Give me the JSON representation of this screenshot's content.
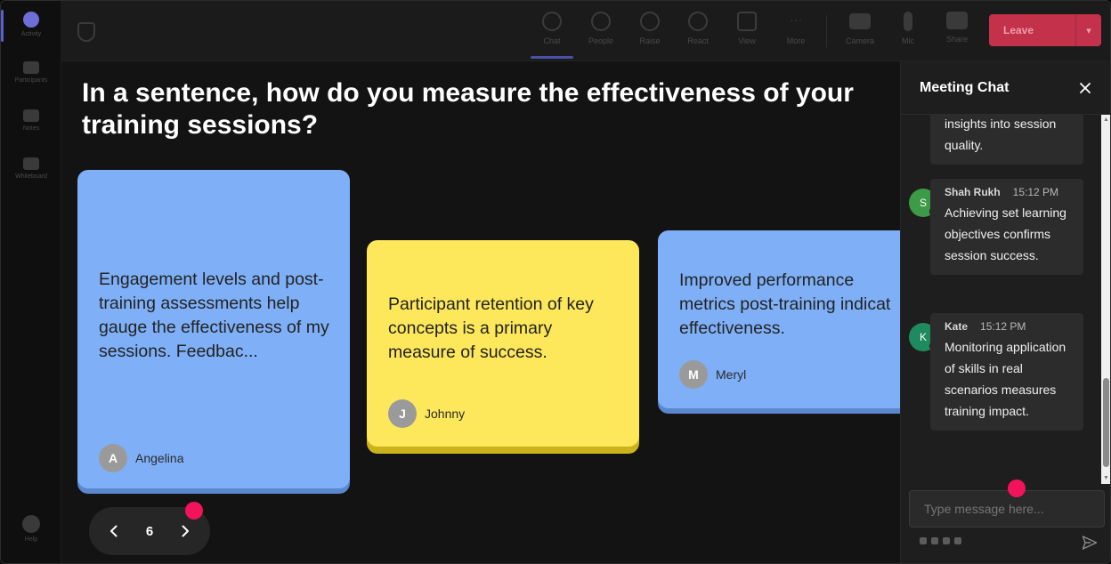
{
  "rail": {
    "items": [
      {
        "label": "Activity"
      },
      {
        "label": "Participants"
      },
      {
        "label": "Notes"
      },
      {
        "label": "Whiteboard"
      },
      {
        "label": "Help"
      }
    ]
  },
  "toolbar": {
    "items": [
      {
        "label": "Chat",
        "icon": "chat-icon"
      },
      {
        "label": "People",
        "icon": "people-icon"
      },
      {
        "label": "Raise",
        "icon": "hand-icon"
      },
      {
        "label": "React",
        "icon": "smile-icon"
      },
      {
        "label": "View",
        "icon": "grid-icon"
      },
      {
        "label": "More",
        "icon": "more-icon"
      },
      {
        "label": "Camera",
        "icon": "camera-icon"
      },
      {
        "label": "Mic",
        "icon": "mic-icon"
      },
      {
        "label": "Share",
        "icon": "share-icon"
      }
    ],
    "leave_label": "Leave"
  },
  "stage": {
    "question": "In a sentence, how do you measure the effectiveness of your training sessions?",
    "cards": [
      {
        "text": "Engagement levels and post-training assessments help gauge the effectiveness of my sessions. Feedbac...",
        "author": "Angelina",
        "initial": "A",
        "color": "#7fb0f7"
      },
      {
        "text": "Participant retention of key concepts is a primary measure of success.",
        "author": "Johnny",
        "initial": "J",
        "color": "#fde85c"
      },
      {
        "text": "Improved performance metrics post-training indicat effectiveness.",
        "author": "Meryl",
        "initial": "M",
        "color": "#7fb0f7"
      }
    ],
    "pager": {
      "page": "6"
    }
  },
  "chat": {
    "title": "Meeting Chat",
    "messages": [
      {
        "name": "",
        "time": "",
        "text": "insights into session quality."
      },
      {
        "name": "Shah Rukh",
        "time": "15:12 PM",
        "initial": "S",
        "avatar_color": "#3d9a46",
        "text": "Achieving set learning objectives confirms session success."
      },
      {
        "name": "Kate",
        "time": "15:12 PM",
        "initial": "K",
        "avatar_color": "#1f8a5e",
        "text": "Monitoring application of skills in real scenarios measures training impact."
      }
    ],
    "compose_placeholder": "Type message here..."
  },
  "colors": {
    "accent": "#5b5fc7",
    "leave": "#c4314b",
    "marker": "#f2135c"
  }
}
